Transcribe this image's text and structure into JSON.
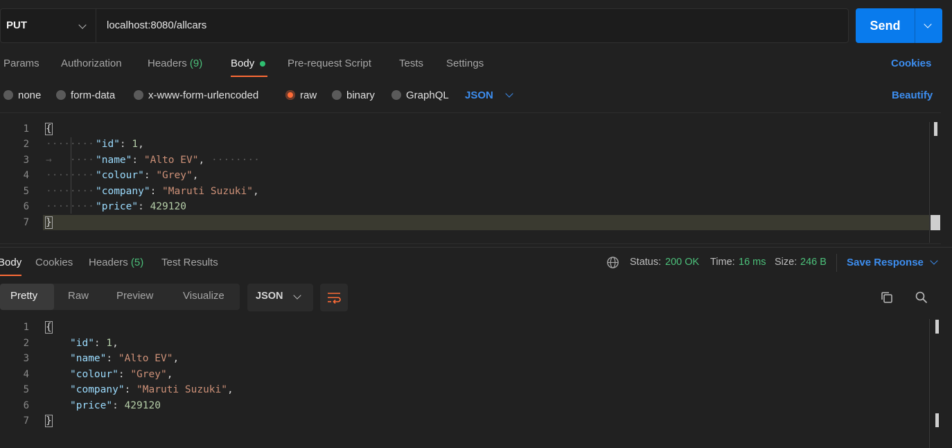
{
  "request": {
    "method": "PUT",
    "url": "localhost:8080/allcars",
    "send_label": "Send"
  },
  "tabs": [
    {
      "label": "Params"
    },
    {
      "label": "Authorization"
    },
    {
      "label": "Headers",
      "count": "(9)"
    },
    {
      "label": "Body"
    },
    {
      "label": "Pre-request Script"
    },
    {
      "label": "Tests"
    },
    {
      "label": "Settings"
    }
  ],
  "cookies_label": "Cookies",
  "body_types": [
    "none",
    "form-data",
    "x-www-form-urlencoded",
    "raw",
    "binary",
    "GraphQL"
  ],
  "selected_body_type": "raw",
  "format_label": "JSON",
  "beautify_label": "Beautify",
  "request_body": {
    "line_numbers": [
      "1",
      "2",
      "3",
      "4",
      "5",
      "6",
      "7"
    ],
    "open_brace": "{",
    "close_brace": "}",
    "fields": [
      {
        "key": "\"id\"",
        "value": "1",
        "type": "number",
        "comma": ","
      },
      {
        "key": "\"name\"",
        "value": "\"Alto EV\"",
        "type": "string",
        "comma": ","
      },
      {
        "key": "\"colour\"",
        "value": "\"Grey\"",
        "type": "string",
        "comma": ","
      },
      {
        "key": "\"company\"",
        "value": "\"Maruti Suzuki\"",
        "type": "string",
        "comma": ","
      },
      {
        "key": "\"price\"",
        "value": "429120",
        "type": "number",
        "comma": ""
      }
    ]
  },
  "response": {
    "tabs": [
      {
        "label": "Body"
      },
      {
        "label": "Cookies"
      },
      {
        "label": "Headers",
        "count": "(5)"
      },
      {
        "label": "Test Results"
      }
    ],
    "status_label": "Status:",
    "status_value": "200 OK",
    "time_label": "Time:",
    "time_value": "16 ms",
    "size_label": "Size:",
    "size_value": "246 B",
    "save_label": "Save Response",
    "view_modes": [
      "Pretty",
      "Raw",
      "Preview",
      "Visualize"
    ],
    "selected_view": "Pretty",
    "format_label": "JSON",
    "line_numbers": [
      "1",
      "2",
      "3",
      "4",
      "5",
      "6",
      "7"
    ],
    "open_brace": "{",
    "close_brace": "}",
    "fields": [
      {
        "key": "\"id\"",
        "value": "1",
        "type": "number",
        "comma": ","
      },
      {
        "key": "\"name\"",
        "value": "\"Alto EV\"",
        "type": "string",
        "comma": ","
      },
      {
        "key": "\"colour\"",
        "value": "\"Grey\"",
        "type": "string",
        "comma": ","
      },
      {
        "key": "\"company\"",
        "value": "\"Maruti Suzuki\"",
        "type": "string",
        "comma": ","
      },
      {
        "key": "\"price\"",
        "value": "429120",
        "type": "number",
        "comma": ""
      }
    ]
  },
  "icons": {
    "method_dropdown": "chevron-down-icon",
    "send_dropdown": "chevron-down-icon",
    "globe": "globe-icon",
    "wrap": "wrap-lines-icon",
    "copy": "copy-icon",
    "search": "search-icon"
  },
  "colors": {
    "accent": "#ff6c37",
    "send": "#097bed",
    "link": "#3d8ef0",
    "ok": "#4cc07a"
  }
}
